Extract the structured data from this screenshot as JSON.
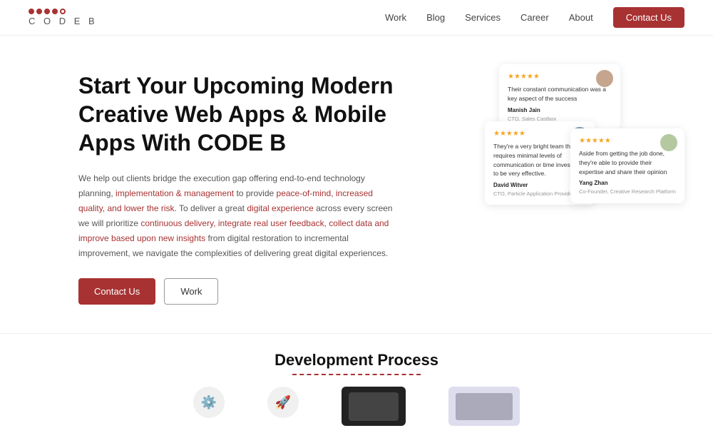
{
  "nav": {
    "logo_dots": [
      "red",
      "red",
      "red",
      "red",
      "outline"
    ],
    "logo_text": "C O D E  B",
    "links": [
      {
        "label": "Work",
        "id": "work"
      },
      {
        "label": "Blog",
        "id": "blog"
      },
      {
        "label": "Services",
        "id": "services"
      },
      {
        "label": "Career",
        "id": "career"
      },
      {
        "label": "About",
        "id": "about"
      }
    ],
    "contact_btn": "Contact Us"
  },
  "hero": {
    "title": "Start Your Upcoming Modern Creative Web Apps & Mobile Apps With CODE B",
    "description": "We help out clients bridge the execution gap offering end-to-end technology planning, implementation & management to provide peace-of-mind, increased quality, and lower the risk. To deliver a great digital experience across every screen we will prioritize continuous delivery, integrate real user feedback, collect data and improve based upon new insights from digital restoration to incremental improvement, we navigate the complexities of delivering great digital experiences.",
    "btn_contact": "Contact Us",
    "btn_work": "Work"
  },
  "testimonials": [
    {
      "stars": "★★★★★",
      "text": "Their constant communication was a key aspect of the success",
      "author": "Manish Jain",
      "role": "CTO, Sales Castbox"
    },
    {
      "stars": "★★★★★",
      "text": "They're a very bright team that requires minimal levels of communication or time investment to be very effective.",
      "author": "David Witver",
      "role": "CTO, Particle Application Provider"
    },
    {
      "stars": "★★★★★",
      "text": "Aside from getting the job done, they're able to provide their expertise and share their opinion",
      "author": "Yang Zhan",
      "role": "Co-Founder, Creative Research Platform"
    }
  ],
  "development": {
    "title": "Development Process",
    "underline_color": "#a83232"
  }
}
